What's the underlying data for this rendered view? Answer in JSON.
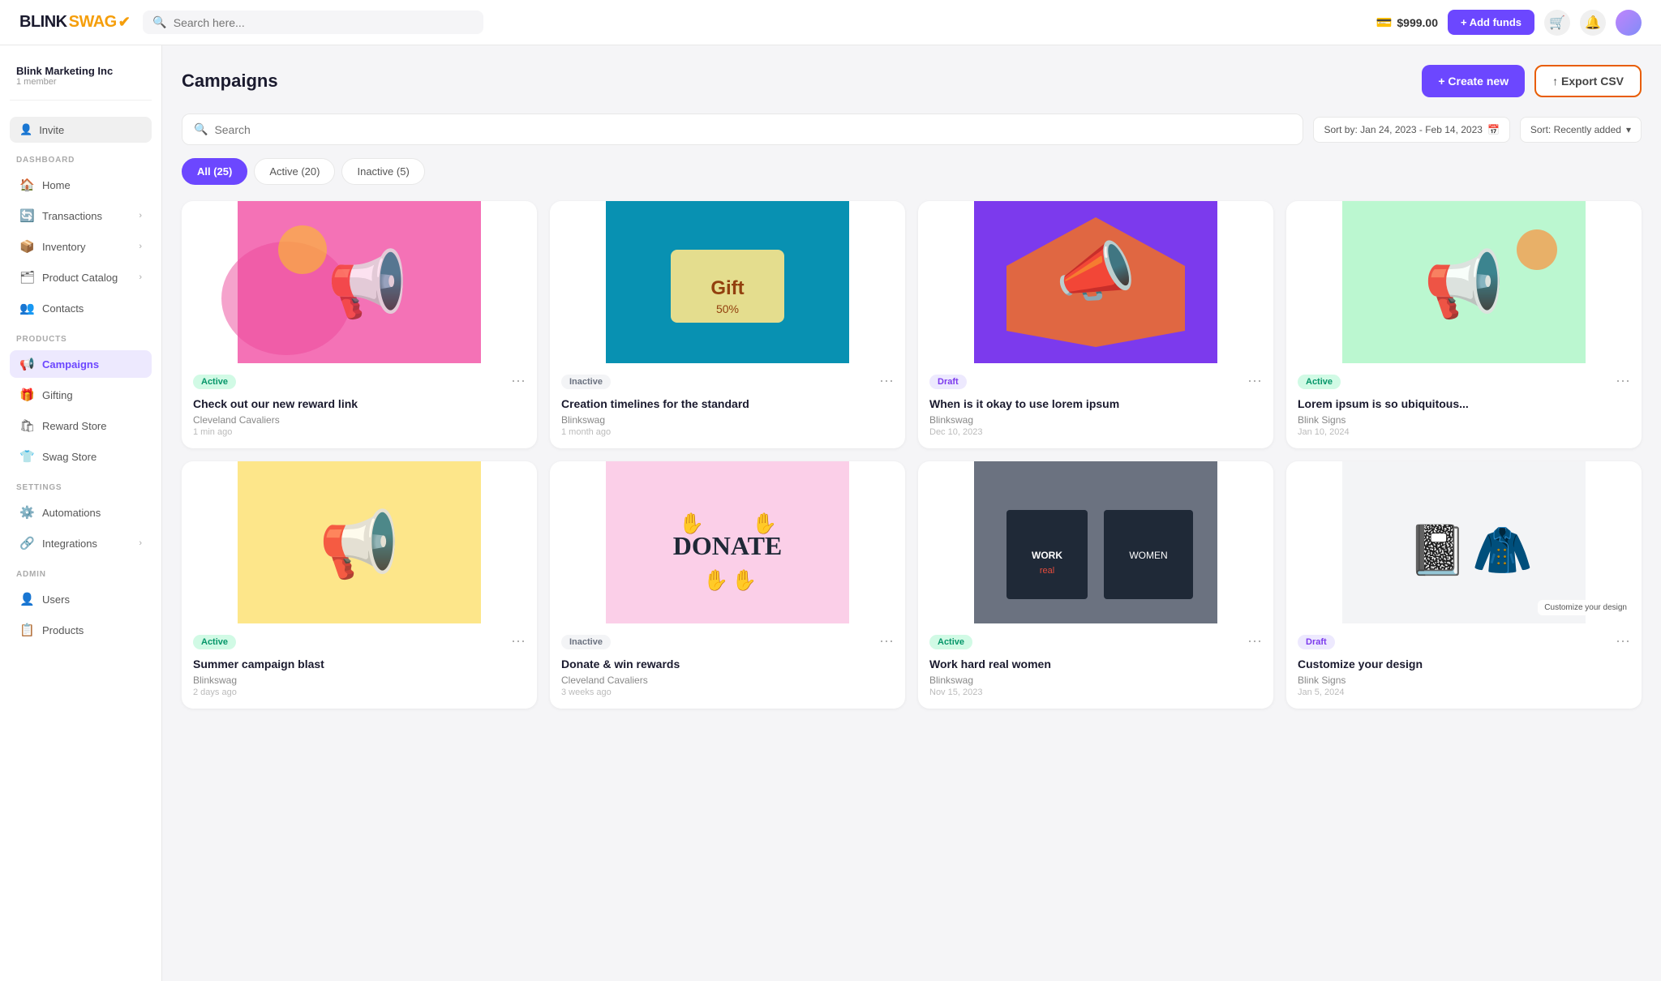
{
  "topnav": {
    "logo": "BLINKSWAG",
    "logo_check": "✓",
    "search_placeholder": "Search here...",
    "balance": "$999.00",
    "add_funds_label": "+ Add funds"
  },
  "sidebar": {
    "org_name": "Blink Marketing Inc",
    "org_member": "1 member",
    "invite_label": "Invite",
    "sections": [
      {
        "label": "DASHBOARD",
        "items": [
          {
            "id": "home",
            "label": "Home",
            "icon": "🏠",
            "active": false
          },
          {
            "id": "transactions",
            "label": "Transactions",
            "icon": "🔄",
            "active": false,
            "chevron": true
          },
          {
            "id": "inventory",
            "label": "Inventory",
            "icon": "📦",
            "active": false,
            "chevron": true
          },
          {
            "id": "product-catalog",
            "label": "Product Catalog",
            "icon": "🗂",
            "active": false,
            "chevron": true
          },
          {
            "id": "contacts",
            "label": "Contacts",
            "icon": "👥",
            "active": false
          }
        ]
      },
      {
        "label": "PRODUCTS",
        "items": [
          {
            "id": "campaigns",
            "label": "Campaigns",
            "icon": "📢",
            "active": true
          },
          {
            "id": "gifting",
            "label": "Gifting",
            "icon": "🎁",
            "active": false
          },
          {
            "id": "reward-store",
            "label": "Reward Store",
            "icon": "🛍",
            "active": false
          },
          {
            "id": "swag-store",
            "label": "Swag Store",
            "icon": "👕",
            "active": false
          }
        ]
      },
      {
        "label": "SETTINGS",
        "items": [
          {
            "id": "automations",
            "label": "Automations",
            "icon": "⚙️",
            "active": false
          },
          {
            "id": "integrations",
            "label": "Integrations",
            "icon": "🔗",
            "active": false,
            "chevron": true
          }
        ]
      },
      {
        "label": "ADMIN",
        "items": [
          {
            "id": "users",
            "label": "Users",
            "icon": "👤",
            "active": false
          },
          {
            "id": "products",
            "label": "Products",
            "icon": "📋",
            "active": false
          }
        ]
      }
    ]
  },
  "page": {
    "title": "Campaigns",
    "create_label": "+ Create new",
    "export_label": "↑ Export CSV",
    "search_placeholder": "Search",
    "sort_date_label": "Sort by: Jan 24, 2023 - Feb 14, 2023",
    "sort_recent_label": "Sort: Recently added"
  },
  "tabs": [
    {
      "label": "All (25)",
      "active": true
    },
    {
      "label": "Active (20)",
      "active": false
    },
    {
      "label": "Inactive (5)",
      "active": false
    }
  ],
  "campaigns": [
    {
      "id": 1,
      "title": "Check out our new reward link",
      "org": "Cleveland Cavaliers",
      "time": "1 min ago",
      "status": "Active",
      "status_type": "active",
      "color": "pink"
    },
    {
      "id": 2,
      "title": "Creation timelines for the standard",
      "org": "Blinkswag",
      "time": "1 month ago",
      "status": "Inactive",
      "status_type": "inactive",
      "color": "teal"
    },
    {
      "id": 3,
      "title": "When is it okay to use lorem ipsum",
      "org": "Blinkswag",
      "time": "Dec 10, 2023",
      "status": "Draft",
      "status_type": "draft",
      "color": "purple"
    },
    {
      "id": 4,
      "title": "Lorem ipsum is so ubiquitous...",
      "org": "Blink Signs",
      "time": "Jan 10, 2024",
      "status": "Active",
      "status_type": "active",
      "color": "green"
    },
    {
      "id": 5,
      "title": "Summer campaign blast",
      "org": "Blinkswag",
      "time": "2 days ago",
      "status": "Active",
      "status_type": "active",
      "color": "yellow"
    },
    {
      "id": 6,
      "title": "Donate & win rewards",
      "org": "Cleveland Cavaliers",
      "time": "3 weeks ago",
      "status": "Inactive",
      "status_type": "inactive",
      "color": "pink2"
    },
    {
      "id": 7,
      "title": "Work hard real women",
      "org": "Blinkswag",
      "time": "Nov 15, 2023",
      "status": "Active",
      "status_type": "active",
      "color": "darkgray"
    },
    {
      "id": 8,
      "title": "Customize your design",
      "org": "Blink Signs",
      "time": "Jan 5, 2024",
      "status": "Draft",
      "status_type": "draft",
      "color": "lightgray",
      "customize": true
    }
  ]
}
